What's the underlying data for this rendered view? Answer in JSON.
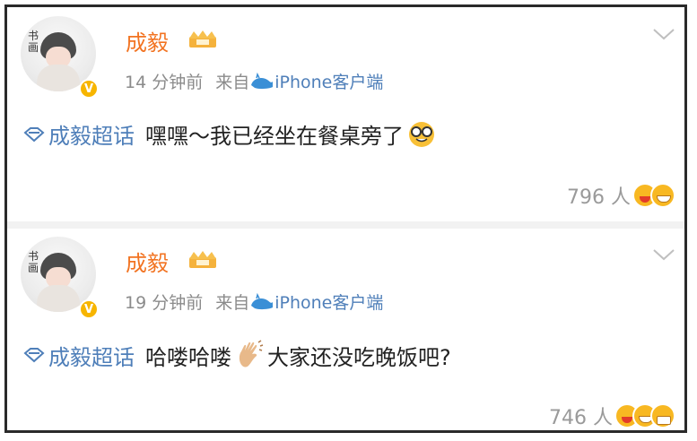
{
  "posts": [
    {
      "user_name": "成毅",
      "time": "14 分钟前",
      "source_prefix": "来自",
      "source": "iPhone客户端",
      "topic": "成毅超话",
      "text": "嘿嘿～我已经坐在餐桌旁了",
      "text_after": "",
      "likes": "796 人",
      "reactions": [
        "red",
        "laugh"
      ]
    },
    {
      "user_name": "成毅",
      "time": "19 分钟前",
      "source_prefix": "来自",
      "source": "iPhone客户端",
      "topic": "成毅超话",
      "text": "哈喽哈喽",
      "text_after": "大家还没吃晚饭吧?",
      "likes": "746 人",
      "reactions": [
        "red",
        "laugh",
        "grin"
      ]
    }
  ],
  "colors": {
    "name": "#f27321",
    "link": "#4f7fb9",
    "meta": "#8b8b8b",
    "vip": "#f7b500"
  },
  "icons": [
    "vip-badge-icon",
    "crown-badge-icon",
    "whale-icon",
    "chevron-down-icon",
    "topic-diamond-icon",
    "nerd-emoji-icon",
    "wave-emoji-icon"
  ]
}
